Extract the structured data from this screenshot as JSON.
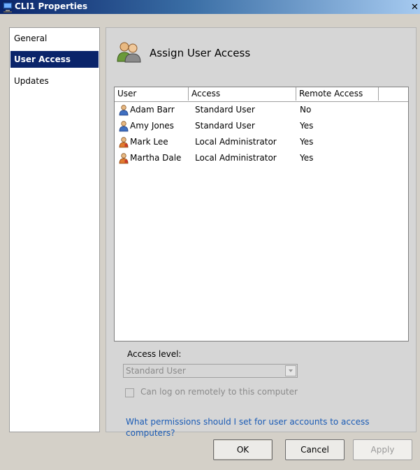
{
  "window": {
    "title": "CLI1 Properties",
    "close_glyph": "✕"
  },
  "nav": {
    "items": [
      {
        "label": "General",
        "selected": false
      },
      {
        "label": "User Access",
        "selected": true
      },
      {
        "label": "Updates",
        "selected": false
      }
    ]
  },
  "section": {
    "title": "Assign User Access",
    "icon": "users-icon"
  },
  "users_table": {
    "columns": [
      "User",
      "Access",
      "Remote Access"
    ],
    "rows": [
      {
        "user": "Adam Barr",
        "access": "Standard User",
        "remote": "No",
        "icon": "standard-user-icon"
      },
      {
        "user": "Amy Jones",
        "access": "Standard User",
        "remote": "Yes",
        "icon": "standard-user-icon"
      },
      {
        "user": "Mark Lee",
        "access": "Local Administrator",
        "remote": "Yes",
        "icon": "admin-user-icon"
      },
      {
        "user": "Martha Dale",
        "access": "Local Administrator",
        "remote": "Yes",
        "icon": "admin-user-icon"
      }
    ]
  },
  "access_level": {
    "label": "Access level:",
    "selected_value": "Standard User",
    "enabled": false
  },
  "remote_logon": {
    "label": "Can log on remotely to this computer",
    "checked": false,
    "enabled": false
  },
  "help_link": "What permissions should I set for user accounts to access computers?",
  "buttons": {
    "ok": "OK",
    "cancel": "Cancel",
    "apply": "Apply"
  },
  "colors": {
    "selection": "#0a246a",
    "link": "#1a5bb5",
    "dialog_background": "#d4d0c8"
  }
}
